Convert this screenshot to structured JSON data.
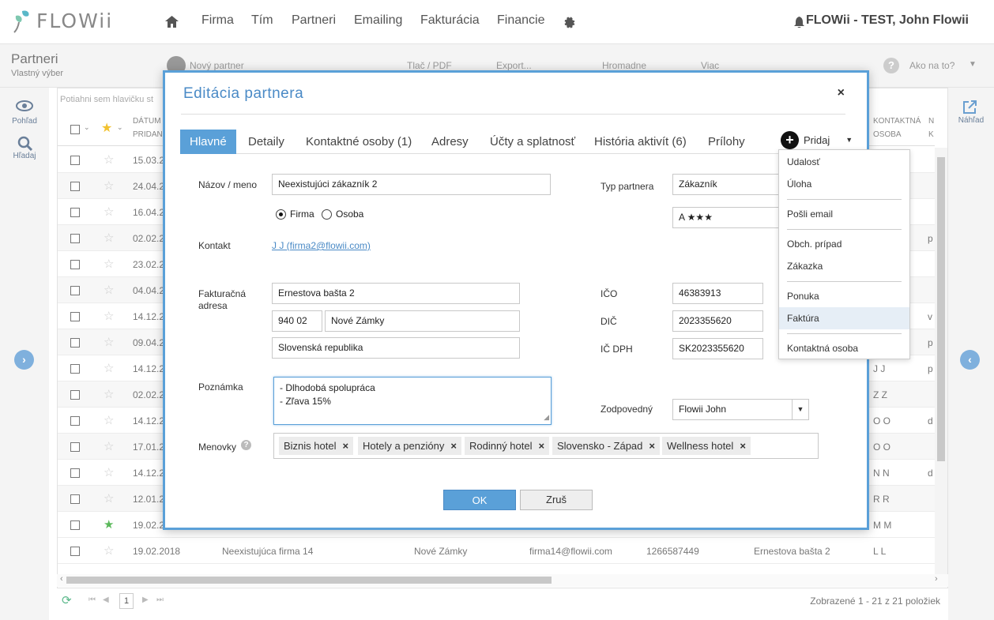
{
  "app": {
    "logo_text": "FLOWii",
    "nav": [
      "Firma",
      "Tím",
      "Partneri",
      "Emailing",
      "Fakturácia",
      "Financie"
    ],
    "user": "FLOWii - TEST, John Flowii"
  },
  "subheader": {
    "title": "Partneri",
    "subtitle": "Vlastný výber",
    "toolbar": {
      "new_partner": "Nový partner",
      "print": "Tlač / PDF",
      "export": "Export...",
      "bulk": "Hromadne",
      "more": "Viac",
      "howto": "Ako na to?"
    }
  },
  "left_panel": {
    "view": "Pohľad",
    "search": "Hľadaj"
  },
  "right_panel": {
    "preview": "Náhľad"
  },
  "grid": {
    "group_hint": "Potiahni sem hlavičku st",
    "header": {
      "date_1": "DÁTUM",
      "date_2": "PRIDAN",
      "contact_1": "KONTAKTNÁ",
      "contact_2": "OSOBA",
      "n_1": "N",
      "n_2": "K"
    },
    "rows": [
      {
        "date": "15.03.2",
        "contact": "",
        "extra": ""
      },
      {
        "date": "24.04.2",
        "contact": "",
        "extra": ""
      },
      {
        "date": "16.04.2",
        "contact": "",
        "extra": ""
      },
      {
        "date": "02.02.2",
        "contact": "",
        "extra": "p"
      },
      {
        "date": "23.02.2",
        "contact": "",
        "extra": ""
      },
      {
        "date": "04.04.2",
        "contact": "",
        "extra": ""
      },
      {
        "date": "14.12.2",
        "contact": "",
        "extra": "v"
      },
      {
        "date": "09.04.2",
        "contact": "",
        "extra": "p"
      },
      {
        "date": "14.12.2",
        "contact": "J J",
        "extra": "p"
      },
      {
        "date": "02.02.2",
        "contact": "Z Z",
        "extra": ""
      },
      {
        "date": "14.12.2",
        "contact": "O O",
        "extra": "d"
      },
      {
        "date": "17.01.2",
        "contact": "O O",
        "extra": ""
      },
      {
        "date": "14.12.2",
        "contact": "N N",
        "extra": "d"
      },
      {
        "date": "12.01.2",
        "contact": "R R",
        "extra": ""
      },
      {
        "date": "19.02.2",
        "contact": "M M",
        "extra": ""
      }
    ],
    "last_row": {
      "date": "19.02.2018",
      "name": "Neexistujúca firma 14",
      "city": "Nové Zámky",
      "email": "firma14@flowii.com",
      "ico": "1266587449",
      "street": "Ernestova bašta 2",
      "contact": "L L"
    },
    "pager": {
      "page": "1",
      "summary": "Zobrazené 1 - 21 z 21 položiek"
    }
  },
  "modal": {
    "title": "Editácia partnera",
    "close": "×",
    "tabs": [
      {
        "label": "Hlavné",
        "active": true
      },
      {
        "label": "Detaily"
      },
      {
        "label": "Kontaktné osoby (1)"
      },
      {
        "label": "Adresy"
      },
      {
        "label": "Účty a splatnosť"
      },
      {
        "label": "História aktivít (6)"
      },
      {
        "label": "Prílohy"
      }
    ],
    "add_button": "Pridaj",
    "form": {
      "name_label": "Názov / meno",
      "name_value": "Neexistujúci zákazník 2",
      "radio_firma": "Firma",
      "radio_osoba": "Osoba",
      "contact_label": "Kontakt",
      "contact_value": "J J (firma2@flowii.com)",
      "billing_label": "Fakturačná adresa",
      "street": "Ernestova bašta 2",
      "zip": "940 02",
      "city": "Nové Zámky",
      "country": "Slovenská republika",
      "note_label": "Poznámka",
      "note_lines": [
        "- Dlhodobá spolupráca",
        "- Zľava 15%"
      ],
      "tags_label": "Menovky",
      "tags": [
        "Biznis hotel",
        "Hotely a penzióny",
        "Rodinný hotel",
        "Slovensko - Západ",
        "Wellness hotel"
      ],
      "type_label": "Typ partnera",
      "type_value": "Zákazník",
      "rating_value": "A ★★★",
      "ico_label": "IČO",
      "ico_value": "46383913",
      "dic_label": "DIČ",
      "dic_value": "2023355620",
      "icdph_label": "IČ DPH",
      "icdph_value": "SK2023355620",
      "owner_label": "Zodpovedný",
      "owner_value": "Flowii John"
    },
    "ok": "OK",
    "cancel": "Zruš"
  },
  "add_menu": {
    "items": [
      "Udalosť",
      "Úloha",
      "Pošli email",
      "Obch. prípad",
      "Zákazka",
      "Ponuka",
      "Faktúra",
      "Kontaktná osoba"
    ],
    "highlighted": "Faktúra"
  },
  "colors": {
    "accent": "#5aa0d8",
    "logo_leaf": "#4fb3c9"
  }
}
